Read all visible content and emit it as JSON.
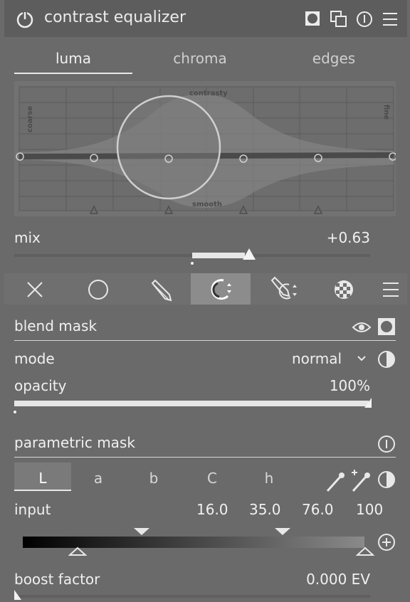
{
  "header": {
    "title": "contrast equalizer"
  },
  "tabs": [
    {
      "label": "luma"
    },
    {
      "label": "chroma"
    },
    {
      "label": "edges"
    }
  ],
  "graph": {
    "label_top": "contrasty",
    "label_bottom": "smooth",
    "label_left": "coarse",
    "label_right": "fine"
  },
  "mix": {
    "label": "mix",
    "value": "+0.63",
    "level": 0.63
  },
  "blend": {
    "title": "blend mask",
    "mode_label": "mode",
    "mode_value": "normal",
    "opacity_label": "opacity",
    "opacity_value": "100%",
    "opacity_level": 1.0
  },
  "parametric": {
    "title": "parametric mask",
    "channels": [
      "L",
      "a",
      "b",
      "C",
      "h"
    ],
    "input_label": "input",
    "input_values": [
      "16.0",
      "35.0",
      "76.0",
      "100"
    ],
    "boost_label": "boost factor",
    "boost_value": "0.000 EV"
  }
}
